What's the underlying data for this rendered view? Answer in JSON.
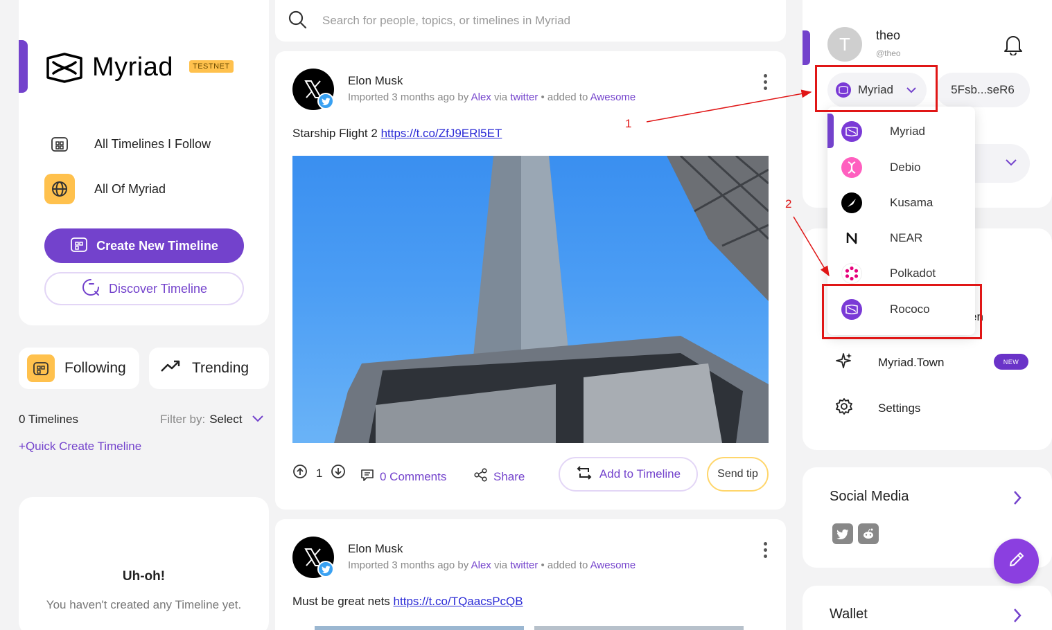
{
  "brand": {
    "name": "Myriad",
    "badge": "TESTNET"
  },
  "nav": {
    "all_following": "All Timelines I Follow",
    "all_myriad": "All Of Myriad",
    "create_timeline": "Create New Timeline",
    "discover_timeline": "Discover Timeline"
  },
  "tabs": {
    "following": "Following",
    "trending": "Trending"
  },
  "timelines": {
    "count": "0 Timelines",
    "filter_label": "Filter by:",
    "filter_value": "Select",
    "quick_create": "Quick Create Timeline"
  },
  "empty": {
    "title": "Uh-oh!",
    "text": "You haven't created any Timeline yet."
  },
  "search": {
    "placeholder": "Search for people, topics, or timelines in Myriad"
  },
  "posts": [
    {
      "author": "Elon Musk",
      "meta_prefix": "Imported 3 months ago by",
      "importer": "Alex",
      "via": "via",
      "source": "twitter",
      "added": "• added to",
      "timeline": "Awesome",
      "text": "Starship Flight 2",
      "link": "https://t.co/ZfJ9ERl5ET",
      "upvotes": "1",
      "comments": "0 Comments",
      "share": "Share",
      "add_to_timeline": "Add to Timeline",
      "send_tip": "Send tip"
    },
    {
      "author": "Elon Musk",
      "meta_prefix": "Imported 3 months ago by",
      "importer": "Alex",
      "via": "via",
      "source": "twitter",
      "added": "• added to",
      "timeline": "Awesome",
      "text": "Must be great nets",
      "link": "https://t.co/TQaacsPcQB"
    }
  ],
  "user": {
    "initial": "T",
    "name": "theo",
    "handle": "@theo",
    "network": "Myriad",
    "address": "5Fsb...seR6"
  },
  "network_dropdown": [
    "Myriad",
    "Debio",
    "Kusama",
    "NEAR",
    "Polkadot",
    "Rococo"
  ],
  "partially_hidden": {
    "menu_fragment": "en"
  },
  "right_menu": {
    "town": "Myriad.Town",
    "new_badge": "NEW",
    "settings": "Settings"
  },
  "social": {
    "title": "Social Media"
  },
  "wallet": {
    "title": "Wallet"
  },
  "annotations": {
    "one": "1",
    "two": "2"
  },
  "colors": {
    "accent": "#7342cc",
    "yellow": "#ffc14d",
    "annotation": "#e01616"
  }
}
